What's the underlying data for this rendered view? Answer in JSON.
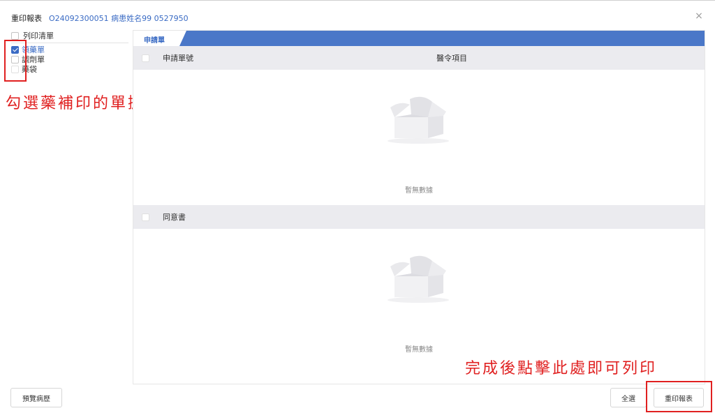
{
  "dialog": {
    "title": "重印報表",
    "patient_info": "O24092300051 病患姓名99 0527950",
    "close_symbol": "×"
  },
  "print_list": {
    "header": "列印清單",
    "items": [
      {
        "label": "領藥單",
        "checked": true
      },
      {
        "label": "調劑單",
        "checked": false
      },
      {
        "label": "藥袋",
        "checked": false
      }
    ]
  },
  "annotations": {
    "left": "勾選藥補印的單據",
    "right": "完成後點擊此處即可列印",
    "color": "#e02020"
  },
  "panel": {
    "tab_label": "申請單",
    "section1": {
      "col_order_no": "申請單號",
      "col_order_item": "醫令項目",
      "empty_text": "暫無數據"
    },
    "section2": {
      "header": "同意書",
      "empty_text": "暫無數據"
    }
  },
  "buttons": {
    "preview_history": "預覽病歷",
    "select_all": "全選",
    "reprint": "重印報表"
  },
  "colors": {
    "accent": "#3a6bc4",
    "tab_strip": "#4a77c8",
    "header_bg": "#ebebef"
  }
}
